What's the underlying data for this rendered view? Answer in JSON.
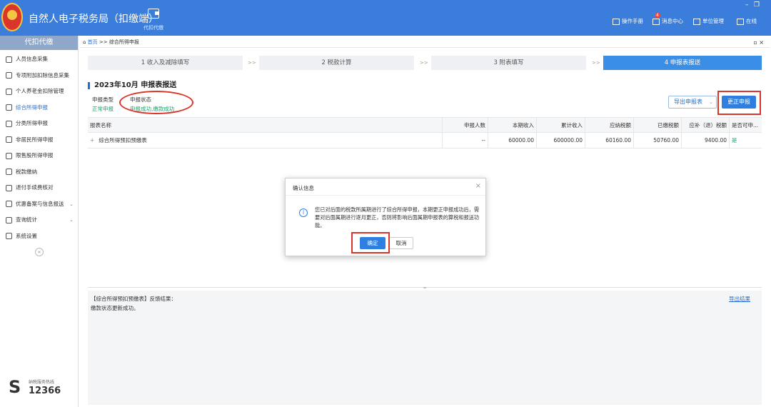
{
  "app": {
    "title": "自然人电子税务局（扣缴端）",
    "logo_text": "中国税务",
    "top_nav_label": "代扣代缴"
  },
  "toolbar": {
    "manual": "操作手册",
    "messages": "消息中心",
    "messages_badge": "4",
    "org_manage": "单位管理",
    "online": "在线",
    "minimize": "–",
    "restore": "❐"
  },
  "sidebar": {
    "header": "代扣代缴",
    "items": [
      {
        "label": "人员信息采集",
        "icon": "person-icon"
      },
      {
        "label": "专项附加扣除信息采集",
        "icon": "list-icon"
      },
      {
        "label": "个人养老金扣除管理",
        "icon": "document-icon"
      },
      {
        "label": "综合所得申报",
        "icon": "chart-icon"
      },
      {
        "label": "分类所得申报",
        "icon": "clock-icon"
      },
      {
        "label": "非居民所得申报",
        "icon": "person-icon"
      },
      {
        "label": "限售股所得申报",
        "icon": "bar-chart-icon"
      },
      {
        "label": "税款缴纳",
        "icon": "folder-icon"
      },
      {
        "label": "退付手续费核对",
        "icon": "form-icon"
      },
      {
        "label": "优惠备案与信息报送",
        "icon": "inbox-icon"
      },
      {
        "label": "查询统计",
        "icon": "search-icon"
      },
      {
        "label": "系统设置",
        "icon": "gear-icon"
      }
    ],
    "collapse": "«",
    "hotline_label": "纳税服务热线",
    "hotline_number": "12366"
  },
  "breadcrumb": {
    "home": "首页",
    "sep": " >> ",
    "current": "综合所得申报",
    "close": "▫ ×"
  },
  "steps": [
    {
      "label": "1 收入及减除填写"
    },
    {
      "label": "2 税款计算"
    },
    {
      "label": "3 附表填写"
    },
    {
      "label": "4 申报表报送"
    }
  ],
  "step_sep": ">>",
  "section": {
    "title": "2023年10月  申报表报送",
    "type_label": "申报类型",
    "type_value": "正常申报",
    "status_label": "申报状态",
    "status_value": "申报成功,缴款成功",
    "export_button": "导出申报表",
    "correct_button": "更正申报"
  },
  "table": {
    "headers": [
      "报表名称",
      "申报人数",
      "本期收入",
      "累计收入",
      "应纳税额",
      "已缴税额",
      "应补（退）税额",
      "是否可申..."
    ],
    "rows": [
      {
        "name": "综合所得预扣预缴表",
        "count": "--",
        "income": "60000.00",
        "cum_income": "600000.00",
        "tax_payable": "60160.00",
        "tax_paid": "50760.00",
        "tax_due": "9400.00",
        "can_declare": "是"
      }
    ]
  },
  "result": {
    "title": "【综合所得预扣预缴表】反馈结果：",
    "message": "缴款状态更新成功。",
    "export_link": "导出结果"
  },
  "dialog": {
    "title": "确认信息",
    "message": "您已对后面的税款所属期进行了综合所得申报，本期更正申报成功后，需要对后面属期进行逐月更正，否则将影响后面属期申报表的算税和报送功能。",
    "ok": "确定",
    "cancel": "取消",
    "close": "×",
    "info_icon": "i"
  },
  "colors": {
    "header_bg": "#3a7ddb",
    "accent": "#2f7fe0",
    "success": "#1aa36a",
    "annotation": "#d9352b"
  }
}
